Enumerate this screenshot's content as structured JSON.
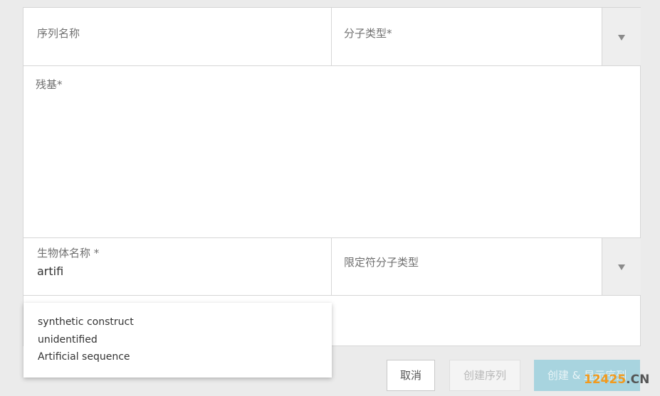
{
  "form": {
    "sequence_name_label": "序列名称",
    "molecule_type_label": "分子类型*",
    "residues_label": "残基*",
    "organism_label": "生物体名称 *",
    "organism_value": "artifi",
    "qualifier_type_label": "限定符分子类型"
  },
  "suggestions": [
    "synthetic construct",
    "unidentified",
    "Artificial sequence"
  ],
  "buttons": {
    "cancel": "取消",
    "create_sequence": "创建序列",
    "create_and_show": "创建 & 显示序列"
  },
  "watermark": {
    "number": "12425",
    "domain": ".CN"
  },
  "colors": {
    "page_bg": "#ebebeb",
    "border": "#d6d6d6",
    "primary_disabled": "#a8d4df",
    "watermark_orange": "#f29a1d"
  }
}
